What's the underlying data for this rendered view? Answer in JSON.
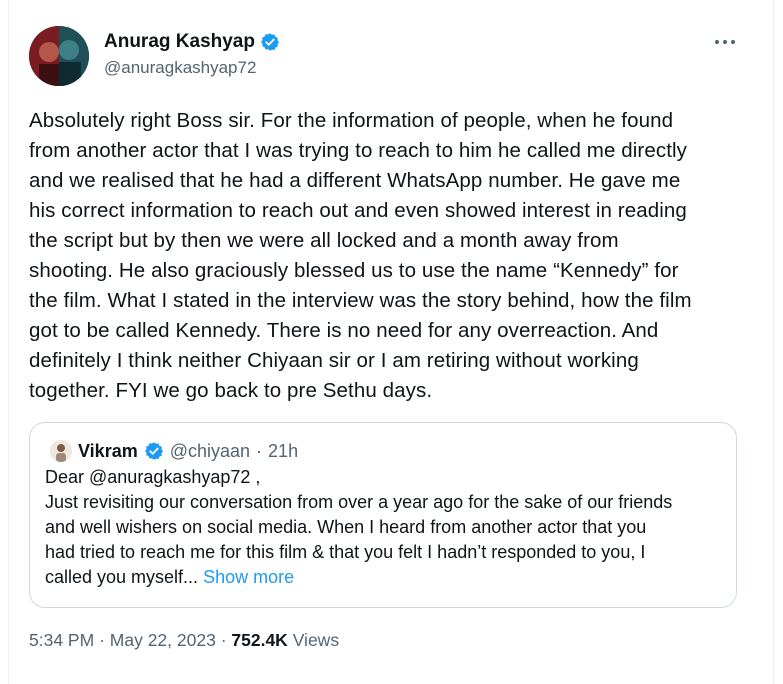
{
  "author": {
    "name": "Anurag Kashyap",
    "handle": "@anuragkashyap72",
    "verified": true
  },
  "tweet": {
    "text": "Absolutely right Boss sir. For the information of people, when he found\nfrom another actor that I was trying to reach to him he called me directly\nand we realised that he had a different WhatsApp number. He gave me\nhis correct information to reach out and even showed interest in reading\nthe script but by then we were all locked and a month away from\nshooting. He also graciously blessed us to use the name “Kennedy” for\nthe film. What I stated in the interview was the story behind, how the film\ngot to be called Kennedy. There is no need for any overreaction. And\ndefinitely I think neither Chiyaan sir or I am retiring without working\ntogether. FYI we go back to pre Sethu days."
  },
  "quoted_tweet": {
    "name": "Vikram",
    "handle": "@chiyaan",
    "separator": "·",
    "time": "21h",
    "text": "Dear @anuragkashyap72 ,\nJust revisiting our conversation from over a year ago for the sake of our friends\nand well wishers on social media. When I heard from another actor that you\nhad tried to reach me for this film & that you felt I hadn’t responded to you, I\ncalled you myself...",
    "show_more_label": "Show more"
  },
  "meta": {
    "time": "5:34 PM",
    "separator": "·",
    "date": "May 22, 2023",
    "views_count": "752.4K",
    "views_label": "Views"
  },
  "colors": {
    "verified_blue": "#1d9bf0",
    "link_blue": "#1d9bf0",
    "secondary_text": "#536471"
  },
  "icons": {
    "more": "more-horizontal-icon",
    "verified": "verified-badge-icon"
  }
}
